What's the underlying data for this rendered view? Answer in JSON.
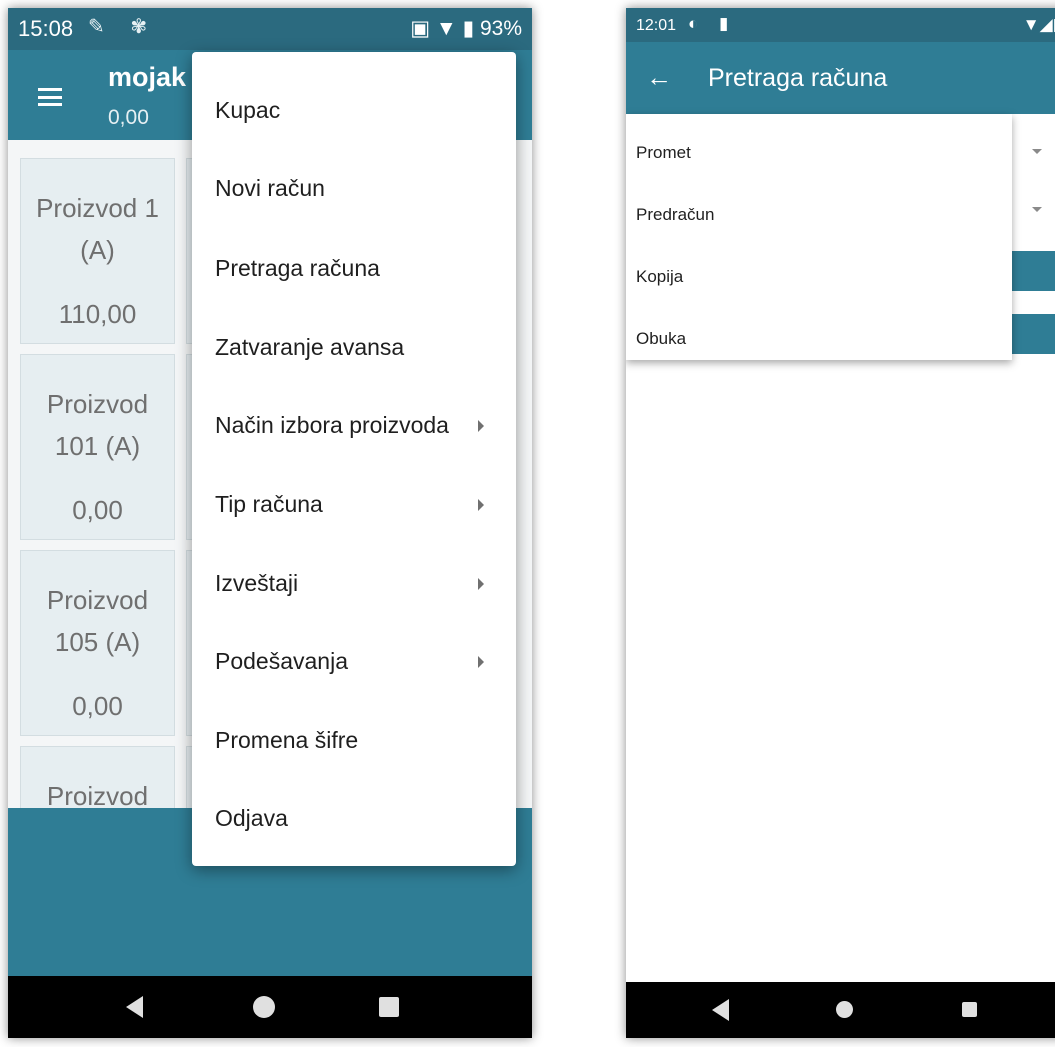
{
  "left_phone": {
    "status_bar": {
      "time": "15:08",
      "battery": "93%"
    },
    "app_bar": {
      "title": "mojak",
      "subtitle": "0,00"
    },
    "products": [
      {
        "name": "Proizvod 1 (A)",
        "line1": "Proizvod 1",
        "line2": "(A)",
        "price": "110,00"
      },
      {
        "name": "Proizvod 101 (A)",
        "line1": "Proizvod",
        "line2": "101 (A)",
        "price": "0,00"
      },
      {
        "name": "Proizvod 105 (A)",
        "line1": "Proizvod",
        "line2": "105 (A)",
        "price": "0,00"
      },
      {
        "name": "Proizvod",
        "line1": "Proizvod",
        "line2": "",
        "price": ""
      }
    ],
    "menu": {
      "items": [
        {
          "label": "Kupac",
          "submenu": false
        },
        {
          "label": "Novi račun",
          "submenu": false
        },
        {
          "label": "Pretraga računa",
          "submenu": false
        },
        {
          "label": "Zatvaranje avansa",
          "submenu": false
        },
        {
          "label": "Način izbora proizvoda",
          "submenu": true
        },
        {
          "label": "Tip računa",
          "submenu": true
        },
        {
          "label": "Izveštaji",
          "submenu": true
        },
        {
          "label": "Podešavanja",
          "submenu": true
        },
        {
          "label": "Promena šifre",
          "submenu": false
        },
        {
          "label": "Odjava",
          "submenu": false
        }
      ]
    }
  },
  "right_phone": {
    "status_bar": {
      "time": "12:01"
    },
    "app_bar": {
      "title": "Pretraga računa"
    },
    "dropdown": {
      "options": [
        "Promet",
        "Predračun",
        "Kopija",
        "Obuka"
      ]
    }
  },
  "colors": {
    "primary": "#2f7d95",
    "status_bar": "#2b6a7f",
    "tile_bg": "#e6eef1",
    "nav_bar": "#000000"
  }
}
